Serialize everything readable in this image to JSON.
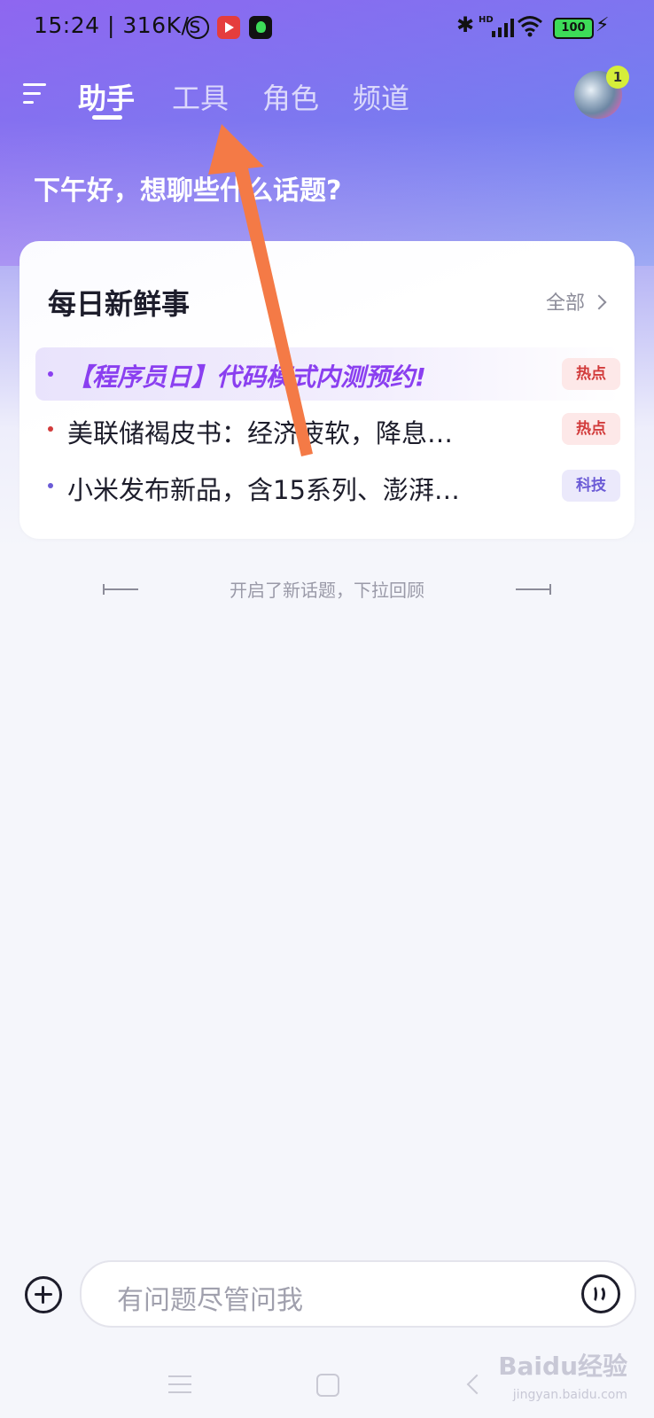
{
  "status_bar": {
    "time_speed": "15:24 | 316K/s",
    "hd": "HD",
    "battery": "100"
  },
  "header": {
    "tabs": [
      {
        "label": "助手",
        "active": true
      },
      {
        "label": "工具",
        "active": false
      },
      {
        "label": "角色",
        "active": false
      },
      {
        "label": "频道",
        "active": false
      }
    ],
    "avatar_badge": "1"
  },
  "greeting": "下午好，想聊些什么话题?",
  "news_card": {
    "title": "每日新鲜事",
    "all_label": "全部",
    "items": [
      {
        "text": "【程序员日】代码模式内测预约!",
        "tag": "热点",
        "dot_color": "#8a3ff0",
        "highlighted": true
      },
      {
        "text": "美联储褐皮书：经济疲软，降息…",
        "tag": "热点",
        "dot_color": "#d23b3b",
        "highlighted": false
      },
      {
        "text": "小米发布新品，含15系列、澎湃…",
        "tag": "科技",
        "dot_color": "#6b5bd6",
        "highlighted": false
      }
    ]
  },
  "divider_text": "开启了新话题，下拉回顾",
  "input": {
    "placeholder": "有问题尽管问我"
  },
  "watermark": {
    "brand": "Baidu经验",
    "url": "jingyan.baidu.com"
  },
  "colors": {
    "accent": "#8a6df0",
    "arrow": "#f47a46",
    "hot_tag": "#d23b3b",
    "tech_tag": "#6b5bd6"
  }
}
